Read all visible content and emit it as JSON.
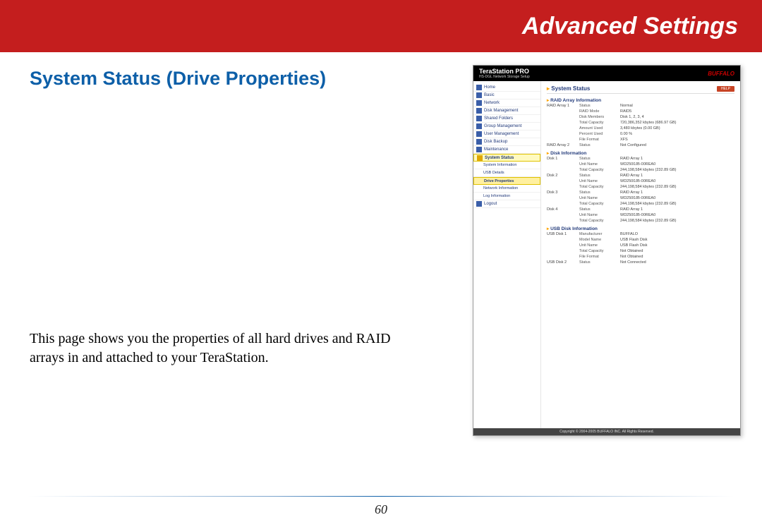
{
  "banner": {
    "title": "Advanced Settings"
  },
  "heading": "System Status (Drive Properties)",
  "body": "This page shows you the properties of all hard drives and RAID arrays in and attached to your TeraStation.",
  "page_number": "60",
  "screenshot": {
    "product": "TeraStation PRO",
    "product_sub": "HS-DGL Network Storage Setup",
    "brand": "BUFFALO",
    "help": "HELP",
    "page_title": "System Status",
    "nav": {
      "items": [
        "Home",
        "Basic",
        "Network",
        "Disk Management",
        "Shared Folders",
        "Group Management",
        "User Management",
        "Disk Backup",
        "Maintenance",
        "System Status",
        "Logout"
      ],
      "sub": [
        "System Information",
        "USB Details",
        "Drive Properties",
        "Network Information",
        "Log Information"
      ],
      "selected": "System Status",
      "selected_sub": "Drive Properties"
    },
    "raid_section": {
      "title": "RAID Array Information",
      "arrays": [
        {
          "name": "RAID Array 1",
          "rows": [
            {
              "k": "Status",
              "v": "Normal"
            },
            {
              "k": "RAID Mode",
              "v": "RAID5"
            },
            {
              "k": "Disk Members",
              "v": "Disk 1, 2, 3, 4"
            },
            {
              "k": "Total Capacity",
              "v": "720,386,352 kbytes (686.97 GB)"
            },
            {
              "k": "Amount Used",
              "v": "3,480 kbytes (0.00 GB)"
            },
            {
              "k": "Percent Used",
              "v": "0.00 %"
            },
            {
              "k": "File Format",
              "v": "XFS"
            }
          ]
        },
        {
          "name": "RAID Array 2",
          "rows": [
            {
              "k": "Status",
              "v": "Not Configured"
            }
          ]
        }
      ]
    },
    "disk_section": {
      "title": "Disk Information",
      "disks": [
        {
          "name": "Disk 1",
          "rows": [
            {
              "k": "Status",
              "v": "RAID Array 1"
            },
            {
              "k": "Unit Name",
              "v": "WD2500JB-00REA0"
            },
            {
              "k": "Total Capacity",
              "v": "244,198,584 kbytes (232.89 GB)"
            }
          ]
        },
        {
          "name": "Disk 2",
          "rows": [
            {
              "k": "Status",
              "v": "RAID Array 1"
            },
            {
              "k": "Unit Name",
              "v": "WD2500JB-00REA0"
            },
            {
              "k": "Total Capacity",
              "v": "244,198,584 kbytes (232.89 GB)"
            }
          ]
        },
        {
          "name": "Disk 3",
          "rows": [
            {
              "k": "Status",
              "v": "RAID Array 1"
            },
            {
              "k": "Unit Name",
              "v": "WD2500JB-00REA0"
            },
            {
              "k": "Total Capacity",
              "v": "244,198,584 kbytes (232.89 GB)"
            }
          ]
        },
        {
          "name": "Disk 4",
          "rows": [
            {
              "k": "Status",
              "v": "RAID Array 1"
            },
            {
              "k": "Unit Name",
              "v": "WD2500JB-00REA0"
            },
            {
              "k": "Total Capacity",
              "v": "244,198,584 kbytes (232.89 GB)"
            }
          ]
        }
      ]
    },
    "usb_section": {
      "title": "USB Disk Information",
      "disks": [
        {
          "name": "USB Disk 1",
          "rows": [
            {
              "k": "Manufacturer",
              "v": "BUFFALO"
            },
            {
              "k": "Model Name",
              "v": "USB Flash Disk"
            },
            {
              "k": "Unit Name",
              "v": "USB Flash Disk"
            },
            {
              "k": "Total Capacity",
              "v": "Not Obtained"
            },
            {
              "k": "File Format",
              "v": "Not Obtained"
            }
          ]
        },
        {
          "name": "USB Disk 2",
          "rows": [
            {
              "k": "Status",
              "v": "Not Connected"
            }
          ]
        }
      ]
    },
    "footer": "Copyright © 2004-2005 BUFFALO INC. All Rights Reserved."
  }
}
